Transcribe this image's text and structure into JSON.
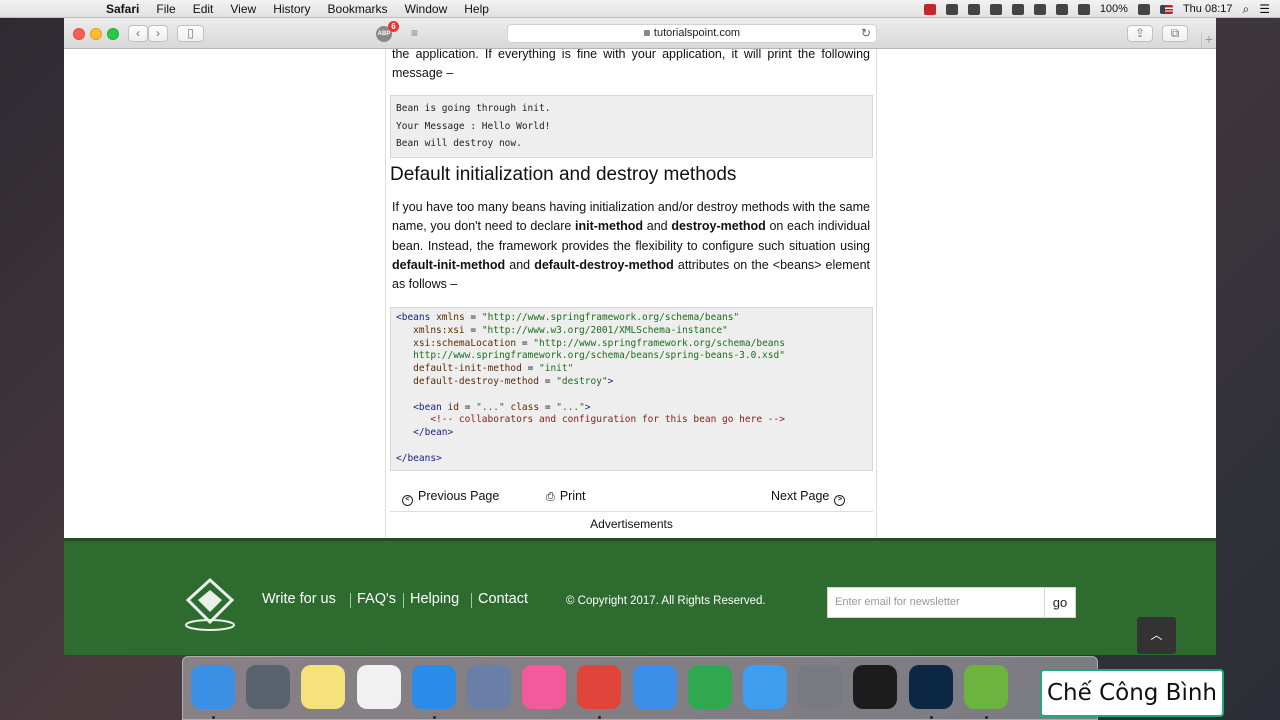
{
  "menubar": {
    "items": [
      {
        "label": "Safari",
        "app": true
      },
      {
        "label": "File"
      },
      {
        "label": "Edit"
      },
      {
        "label": "View"
      },
      {
        "label": "History"
      },
      {
        "label": "Bookmarks"
      },
      {
        "label": "Window"
      },
      {
        "label": "Help"
      }
    ],
    "battery": "100%",
    "clock": "Thu 08:17"
  },
  "browser": {
    "url": "tutorialspoint.com",
    "adblock_label": "ABP",
    "adblock_count": "6"
  },
  "article": {
    "p1": "the application. If everything is fine with your application, it will print the following message –",
    "output_lines": [
      "Bean is going through init.",
      "Your Message : Hello World!",
      "Bean will destroy now."
    ],
    "heading": "Default initialization and destroy methods",
    "p2": {
      "t1": "If you have too many beans having initialization and/or destroy methods with the same name, you don't need to declare ",
      "b1": "init-method",
      "t2": " and ",
      "b2": "destroy-method",
      "t3": " on each individual bean. Instead, the framework provides the flexibility to configure such situation using ",
      "b3": "default-init-method",
      "t4": " and ",
      "b4": "default-destroy-method",
      "t5": " attributes on the <beans> element as follows –"
    },
    "code": {
      "beans_open": "<beans",
      "attr_xmlns": "xmlns",
      "val_xmlns": "\"http://www.springframework.org/schema/beans\"",
      "attr_xsi": "xmlns:xsi",
      "val_xsi": "\"http://www.w3.org/2001/XMLSchema-instance\"",
      "attr_loc": "xsi:schemaLocation",
      "val_loc1": "\"http://www.springframework.org/schema/beans",
      "val_loc2": "http://www.springframework.org/schema/beans/spring-beans-3.0.xsd\"",
      "attr_init": "default-init-method",
      "val_init": "\"init\"",
      "attr_destroy": "default-destroy-method",
      "val_destroy": "\"destroy\"",
      "gt": ">",
      "bean_open": "<bean",
      "attr_id": "id",
      "val_id": "\"...\"",
      "attr_class": "class",
      "val_class": "\"...\"",
      "comment": "<!-- collaborators and configuration for this bean go here -->",
      "bean_close": "</bean>",
      "beans_close": "</beans>",
      "eq": " = "
    }
  },
  "nav": {
    "prev": "Previous Page",
    "print": "Print",
    "next": "Next Page",
    "ads": "Advertisements"
  },
  "footer": {
    "links": [
      "Write for us",
      "FAQ's",
      "Helping",
      "Contact"
    ],
    "copyright": "© Copyright 2017. All Rights Reserved.",
    "email_placeholder": "Enter email for newsletter",
    "go": "go",
    "top_icon": "chevron-up-icon"
  },
  "dock": {
    "apps": [
      {
        "name": "finder-icon",
        "color": "#3b8fe5"
      },
      {
        "name": "launchpad-icon",
        "color": "#5a6270"
      },
      {
        "name": "notes-icon",
        "color": "#f6e27a"
      },
      {
        "name": "photos-icon",
        "color": "#f1f1f1"
      },
      {
        "name": "safari-icon",
        "color": "#2a8ce8"
      },
      {
        "name": "mail-icon",
        "color": "#6a7fa8"
      },
      {
        "name": "itunes-icon",
        "color": "#f45a9b"
      },
      {
        "name": "chrome-icon",
        "color": "#e0443a"
      },
      {
        "name": "xcode-icon",
        "color": "#3d8ee8"
      },
      {
        "name": "camtasia-icon",
        "color": "#2fa84f"
      },
      {
        "name": "app-store-icon",
        "color": "#3d9ef0"
      },
      {
        "name": "system-preferences-icon",
        "color": "#777a80"
      },
      {
        "name": "terminal-icon",
        "color": "#1c1c1c"
      },
      {
        "name": "photoshop-icon",
        "color": "#0b2744"
      },
      {
        "name": "spring-tool-icon",
        "color": "#6db33f"
      }
    ]
  },
  "watermark": "Chế Công Bình"
}
